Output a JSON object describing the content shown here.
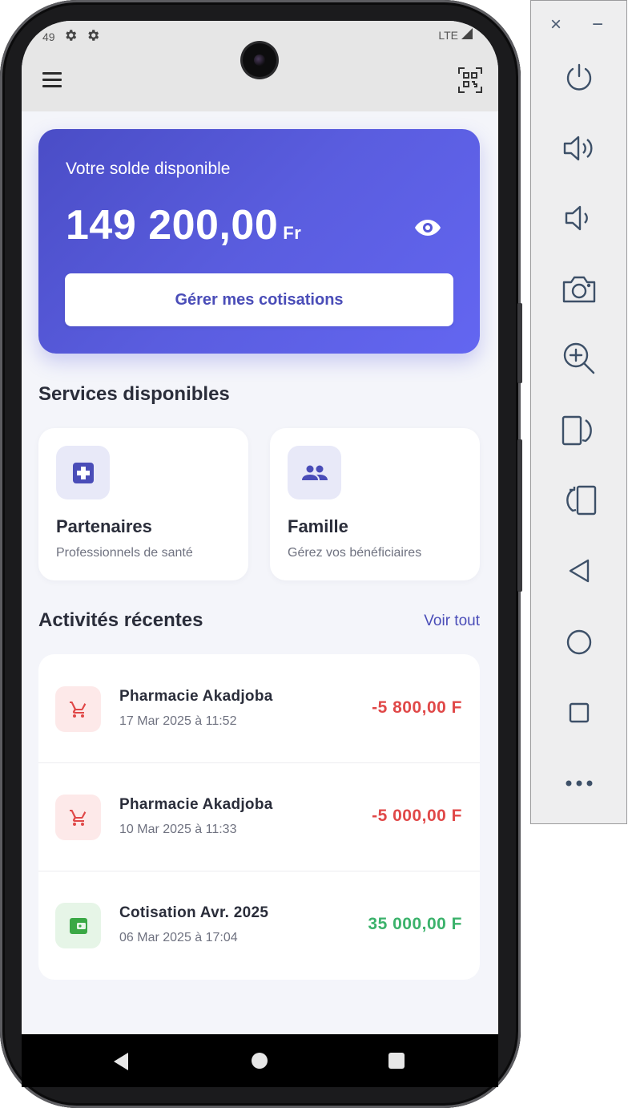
{
  "status_bar": {
    "time": "49",
    "network": "LTE",
    "icons": [
      "gear-icon",
      "gear-icon",
      "signal-icon"
    ]
  },
  "app_bar": {
    "menu_icon": "hamburger-menu-icon",
    "scan_icon": "qr-scan-icon"
  },
  "balance_card": {
    "label": "Votre solde disponible",
    "amount": "149 200,00",
    "currency": "Fr",
    "toggle_icon": "eye-icon",
    "button_label": "Gérer mes cotisations",
    "gradient_start": "#4a4dc6",
    "gradient_end": "#6366f1"
  },
  "services": {
    "title": "Services disponibles",
    "items": [
      {
        "title": "Partenaires",
        "subtitle": "Professionnels de santé",
        "icon": "medical-cross-icon"
      },
      {
        "title": "Famille",
        "subtitle": "Gérez vos bénéficiaires",
        "icon": "people-icon"
      }
    ]
  },
  "activities": {
    "title": "Activités récentes",
    "see_all": "Voir tout",
    "items": [
      {
        "title": "Pharmacie Akadjoba",
        "date": "17 Mar 2025 à 11:52",
        "amount": "-5 800,00 F",
        "type": "debit",
        "icon": "cart-icon"
      },
      {
        "title": "Pharmacie Akadjoba",
        "date": "10 Mar 2025 à 11:33",
        "amount": "-5 000,00 F",
        "type": "debit",
        "icon": "cart-icon"
      },
      {
        "title": "Cotisation Avr. 2025",
        "date": "06 Mar 2025 à 17:04",
        "amount": "35 000,00 F",
        "type": "credit",
        "icon": "wallet-icon"
      }
    ]
  },
  "colors": {
    "accent": "#4a4db8",
    "debit": "#e04848",
    "credit": "#3bb26b"
  },
  "nav_bar": {
    "buttons": [
      "back-icon",
      "home-icon",
      "recents-icon"
    ]
  },
  "emulator_panel": {
    "close": "×",
    "minimize": "−",
    "controls": [
      "power-icon",
      "volume-up-icon",
      "volume-down-icon",
      "camera-icon",
      "zoom-icon",
      "rotate-left-icon",
      "rotate-right-icon",
      "back-icon",
      "home-icon",
      "overview-icon",
      "more-icon"
    ]
  }
}
